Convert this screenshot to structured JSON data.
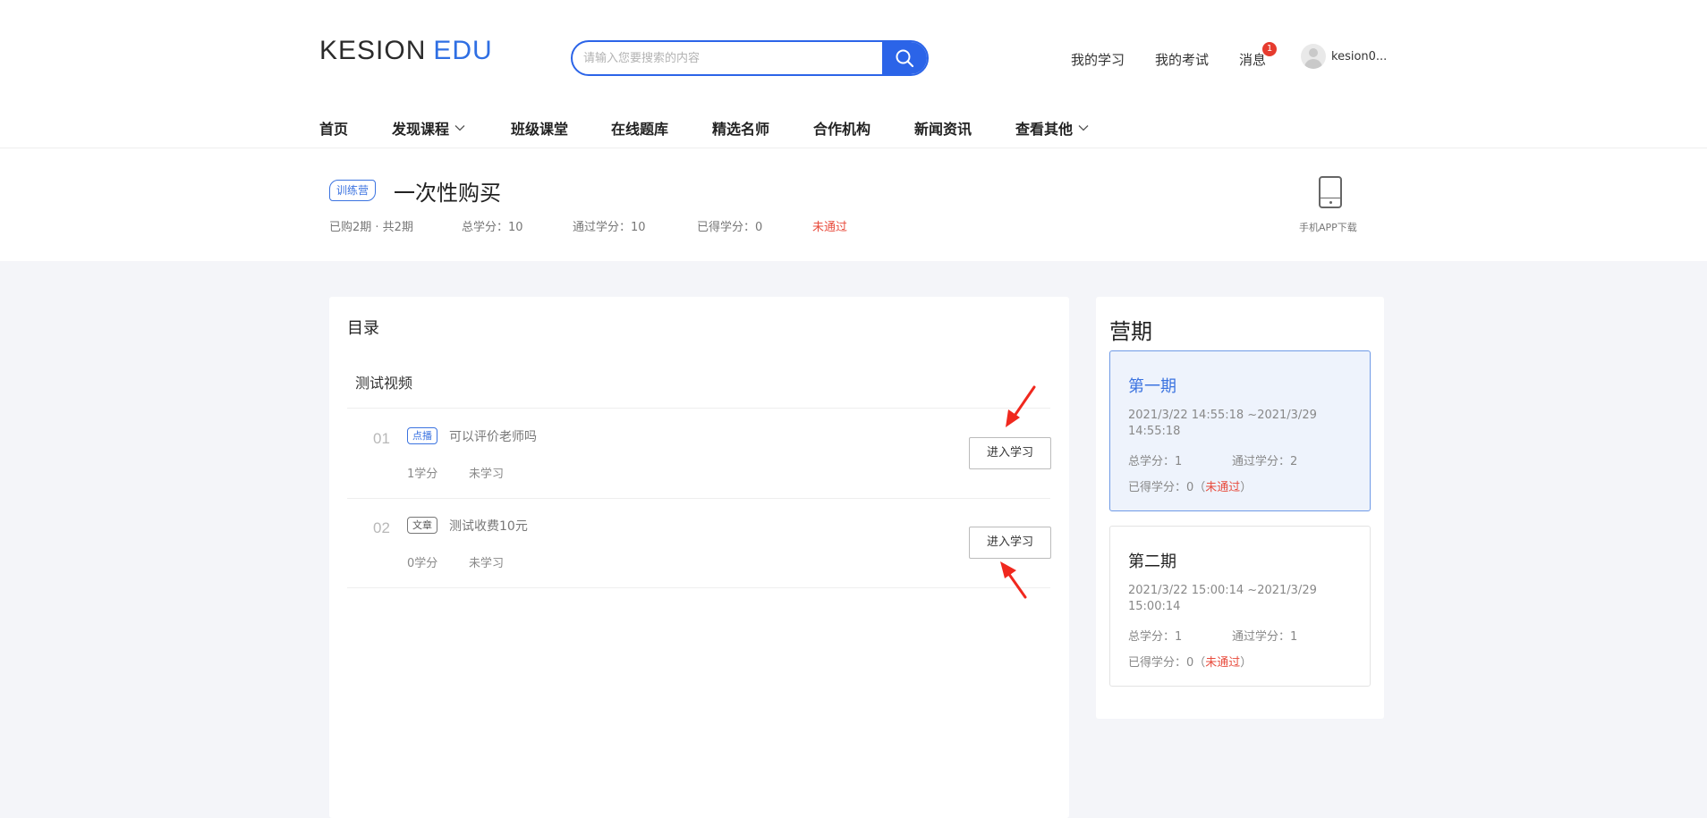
{
  "header": {
    "logo_part1": "KESION",
    "logo_part2": "EDU",
    "search_placeholder": "请输入您要搜索的内容",
    "top_links": [
      "我的学习",
      "我的考试",
      "消息"
    ],
    "message_count": "1",
    "username": "kesion0..."
  },
  "nav": {
    "items": [
      "首页",
      "发现课程",
      "班级课堂",
      "在线题库",
      "精选名师",
      "合作机构",
      "新闻资讯",
      "查看其他"
    ]
  },
  "course": {
    "tag": "训练营",
    "title": "一次性购买",
    "purchased": "已购2期 · 共2期",
    "total_credits": "总学分：10",
    "pass_credits": "通过学分：10",
    "earned_credits": "已得学分：0",
    "status": "未通过",
    "app_download": "手机APP下载"
  },
  "catalog": {
    "title": "目录",
    "section_title": "测试视频",
    "lessons": [
      {
        "num": "01",
        "tag": "点播",
        "name": "可以评价老师吗",
        "credits": "1学分",
        "status": "未学习",
        "button": "进入学习"
      },
      {
        "num": "02",
        "tag": "文章",
        "name": "测试收费10元",
        "credits": "0学分",
        "status": "未学习",
        "button": "进入学习"
      }
    ]
  },
  "camp": {
    "title": "营期",
    "periods": [
      {
        "name": "第一期",
        "date": "2021/3/22 14:55:18 ~2021/3/29 14:55:18",
        "total": "总学分：1",
        "pass": "通过学分：2",
        "earned_prefix": "已得学分：0（",
        "status": "未通过",
        "earned_suffix": "）"
      },
      {
        "name": "第二期",
        "date": "2021/3/22 15:00:14 ~2021/3/29 15:00:14",
        "total": "总学分：1",
        "pass": "通过学分：1",
        "earned_prefix": "已得学分：0（",
        "status": "未通过",
        "earned_suffix": "）"
      }
    ]
  },
  "colors": {
    "accent": "#2b64e8",
    "danger": "#e84c3d"
  }
}
